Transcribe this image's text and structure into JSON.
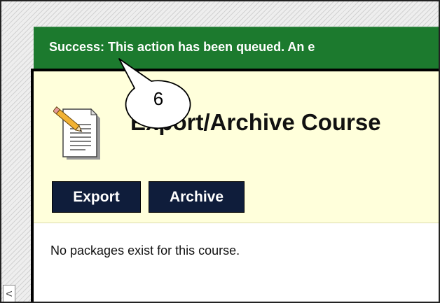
{
  "banner": {
    "message": "Success: This action has been queued. An e"
  },
  "page": {
    "title": "Export/Archive Course",
    "icon": "document-pencil-icon",
    "buttons": {
      "export_label": "Export",
      "archive_label": "Archive"
    },
    "empty_message": "No packages exist for this course."
  },
  "scroll_control": {
    "glyph": "<",
    "icon": "chevron-left-icon"
  },
  "callout": {
    "number": "6"
  },
  "colors": {
    "success_green": "#1c7a2e",
    "panel_yellow": "#ffffdb",
    "button_navy": "#0f1d3b"
  }
}
